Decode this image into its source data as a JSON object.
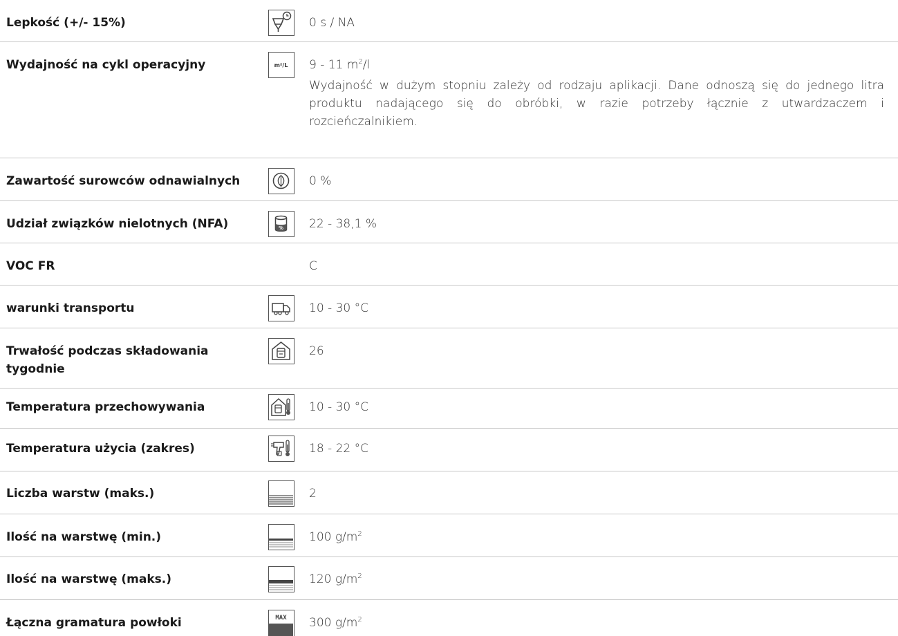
{
  "rows": [
    {
      "label": "Lepkość (+/- 15%)",
      "icon": "viscosity-cup-timer-icon",
      "value": "0 s / NA"
    },
    {
      "label": "Wydajność na cykl operacyjny",
      "icon": "m2-per-liter-icon",
      "value": "9 - 11 m²/l",
      "note": "Wydajność w dużym stopniu zależy od rodzaju aplikacji. Dane odnoszą się do jednego litra produktu nadającego się do obróbki, w razie potrzeby łącznie z utwardzaczem i rozcieńczalnikiem.",
      "icon_text": "m²/L"
    },
    {
      "label": "Zawartość surowców odnawialnych",
      "icon": "renewable-leaf-icon",
      "value": "0 %"
    },
    {
      "label": "Udział związków nielotnych (NFA)",
      "icon": "solids-can-icon",
      "value": "22 - 38,1 %"
    },
    {
      "label": "VOC FR",
      "icon": "",
      "value": "C"
    },
    {
      "label": "warunki transportu",
      "icon": "truck-icon",
      "value": "10 - 30 °C"
    },
    {
      "label": "Trwałość podczas składowania tygodnie",
      "icon": "storage-house-icon",
      "value": "26"
    },
    {
      "label": "Temperatura przechowywania",
      "icon": "storage-thermometer-icon",
      "value": "10 - 30 °C"
    },
    {
      "label": "Temperatura użycia (zakres)",
      "icon": "spray-gun-thermometer-icon",
      "value": "18 - 22 °C"
    },
    {
      "label": "Liczba warstw (maks.)",
      "icon": "layers-icon",
      "value": "2"
    },
    {
      "label": "Ilość na warstwę (min.)",
      "icon": "layer-amount-min-icon",
      "value": "100 g/m²"
    },
    {
      "label": "Ilość na warstwę (maks.)",
      "icon": "layer-amount-max-icon",
      "value": "120 g/m²"
    },
    {
      "label": "Łączna gramatura powłoki",
      "icon": "total-max-icon",
      "value": "300 g/m²",
      "icon_text": "MAX"
    }
  ]
}
